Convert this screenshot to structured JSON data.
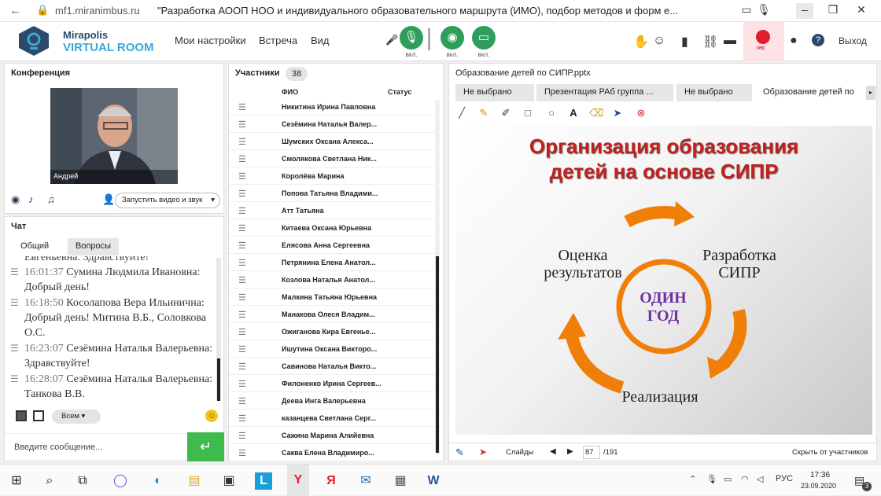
{
  "browser": {
    "url": "mf1.miranimbus.ru",
    "title": "\"Разработка АООП НОО и индивидуального образовательного маршрута (ИМО), подбор методов и форм е..."
  },
  "app": {
    "brand_line1": "Mirapolis",
    "brand_line2": "VIRTUAL ROOM",
    "menu": [
      "Мои настройки",
      "Встреча",
      "Вид"
    ],
    "media_labels": [
      "вкл.",
      "вкл.",
      "вкл."
    ],
    "rec_label": "rec",
    "exit_label": "Выход",
    "colors": {
      "accent_green": "#2e9e5a",
      "rec_red": "#e11d2e",
      "brand_blue": "#38a9d8"
    }
  },
  "conference": {
    "title": "Конференция",
    "video_name": "Андрей",
    "start_button": "Запустить видео и звук"
  },
  "chat": {
    "title": "Чат",
    "tabs": [
      "Общий",
      "Вопросы"
    ],
    "partial_top": "Евгеньевна: Здравствуйте!",
    "messages": [
      {
        "time": "16:01:37",
        "text": "Сумина Людмила Ивановна: Добрый день!"
      },
      {
        "time": "16:18:50",
        "text": "Косолапова Вера Ильинична: Добрый день! Митина В.Б., Соловкова О.С."
      },
      {
        "time": "16:23:07",
        "text": "Сезёмина Наталья Валерьевна: Здравствуйте!"
      },
      {
        "time": "16:28:07",
        "text": "Сезёмина Наталья Валерьевна: Танкова В.В."
      }
    ],
    "recipient": "Всем",
    "input_placeholder": "Введите сообщение..."
  },
  "participants": {
    "title": "Участники",
    "count": "38",
    "col_name": "ФИО",
    "col_status": "Статус",
    "list": [
      "Никитина Ирина  Павловна",
      "Сезёмина Наталья  Валер...",
      "Шумских Оксана  Алекса...",
      "Смолякова Светлана  Ник...",
      "Королёва Марина",
      "Попова Татьяна  Владими...",
      "Атт  Татьяна",
      "Китаева Оксана  Юрьевна",
      "Елясова  Анна Сергеевна",
      "Петрянина Елена  Анатол...",
      "Козлова Наталья  Анатол...",
      "Малкина Татьяна  Юрьевна",
      "Манакова Олеся  Владим...",
      "Ожиганова  Кира Евгенье...",
      "Ишутина Оксана Викторо...",
      "Савинова Наталья  Викто...",
      "Филоненко Ирина Сергеев...",
      "Деева Инга  Валерьевна",
      "казанцева Светлана Серг...",
      "Сажина Марина  Алийевна",
      "Саква  Елена  Владимиро..."
    ]
  },
  "presentation": {
    "title": "Образование детей по СИПР.pptx",
    "tabs": [
      "Не выбрано",
      "Презентация РАб группа ...",
      "Не выбрано",
      "Образование детей по"
    ],
    "slide": {
      "title_line1": "Организация образования",
      "title_line2": "детей на основе СИПР",
      "left_label_1": "Оценка",
      "left_label_2": "результатов",
      "right_label_1": "Разработка",
      "right_label_2": "СИПР",
      "bottom_label": "Реализация",
      "center_1": "ОДИН",
      "center_2": "ГОД"
    },
    "footer": {
      "slides_label": "Слайды",
      "page": "87",
      "total": "/191",
      "hide": "Скрыть от участников"
    }
  },
  "taskbar": {
    "lang": "РУС",
    "time": "17:36",
    "date": "23.09.2020",
    "notif_count": "3"
  }
}
